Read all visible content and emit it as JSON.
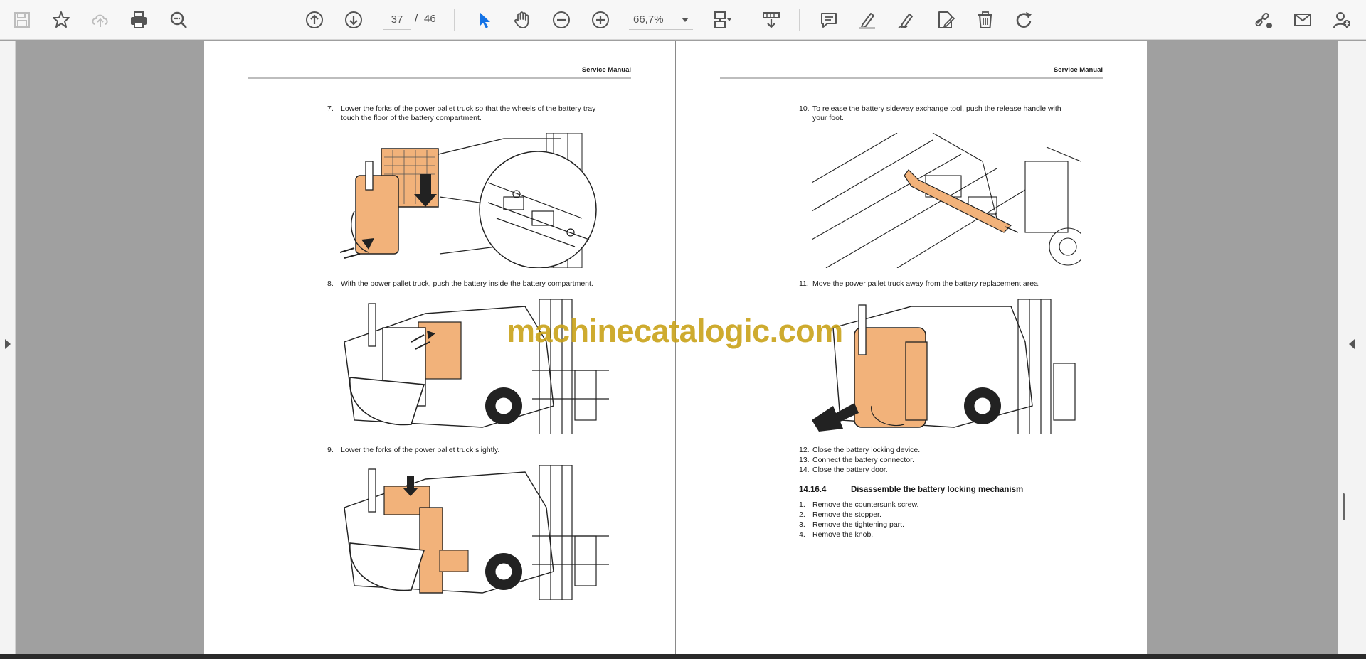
{
  "toolbar": {
    "current_page": "37",
    "separator": "/",
    "total_pages": "46",
    "zoom": "66,7%"
  },
  "left_page": {
    "header": "Service Manual",
    "steps": [
      {
        "num": "7.",
        "lines": [
          "Lower the forks of the power pallet truck so that the wheels of the battery tray",
          "touch the floor of the battery compartment."
        ]
      },
      {
        "num": "8.",
        "lines": [
          "With the power pallet truck, push the battery inside the battery compartment."
        ]
      },
      {
        "num": "9.",
        "lines": [
          "Lower the forks of the power pallet truck slightly."
        ]
      }
    ]
  },
  "right_page": {
    "header": "Service Manual",
    "steps": [
      {
        "num": "10.",
        "lines": [
          "To release the battery sideway exchange tool, push the release handle with",
          "your foot."
        ]
      },
      {
        "num": "11.",
        "lines": [
          "Move the power pallet truck away from the battery replacement area."
        ]
      },
      {
        "num": "12.",
        "lines": [
          "Close the battery locking device."
        ]
      },
      {
        "num": "13.",
        "lines": [
          "Connect the battery connector."
        ]
      },
      {
        "num": "14.",
        "lines": [
          "Close the battery door."
        ]
      }
    ],
    "section": {
      "number": "14.16.4",
      "title": "Disassemble the battery locking mechanism"
    },
    "section_steps": [
      {
        "num": "1.",
        "text": "Remove the countersunk screw."
      },
      {
        "num": "2.",
        "text": "Remove the stopper."
      },
      {
        "num": "3.",
        "text": "Remove the tightening part."
      },
      {
        "num": "4.",
        "text": "Remove the knob."
      }
    ]
  },
  "watermark": "machinecatalogic.com",
  "colors": {
    "accent_blue": "#1473e6",
    "highlight_orange": "#f2b27a",
    "watermark": "#c9a319"
  }
}
